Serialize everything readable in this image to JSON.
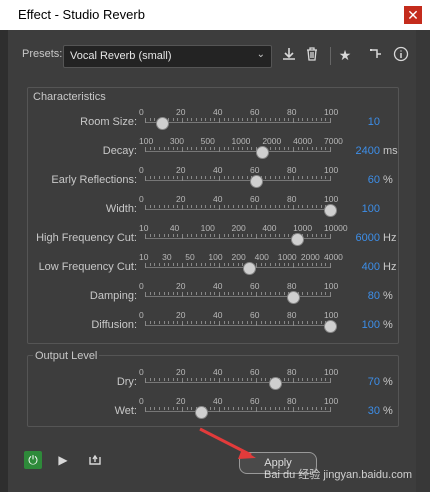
{
  "window": {
    "title": "Effect - Studio Reverb",
    "close_label": "✕"
  },
  "toolbar": {
    "presets_label": "Presets:",
    "preset_value": "Vocal Reverb (small)",
    "icons": [
      "download-icon",
      "trash-icon",
      "star-icon",
      "routing-icon",
      "info-icon"
    ]
  },
  "characteristics": {
    "title": "Characteristics",
    "rows": [
      {
        "label": "Room Size:",
        "scale": [
          "0",
          "20",
          "40",
          "60",
          "80",
          "100"
        ],
        "fraction": 0.09,
        "value": "10",
        "unit": ""
      },
      {
        "label": "Decay:",
        "scale": [
          "100",
          "300",
          "500",
          "1000",
          "2000",
          "4000",
          "7000"
        ],
        "fraction": 0.63,
        "value": "2400",
        "unit": "ms"
      },
      {
        "label": "Early Reflections:",
        "scale": [
          "0",
          "20",
          "40",
          "60",
          "80",
          "100"
        ],
        "fraction": 0.6,
        "value": "60",
        "unit": "%"
      },
      {
        "label": "Width:",
        "scale": [
          "0",
          "20",
          "40",
          "60",
          "80",
          "100"
        ],
        "fraction": 1.0,
        "value": "100",
        "unit": ""
      },
      {
        "label": "High Frequency Cut:",
        "scale": [
          "10",
          "40",
          "100",
          "200",
          "400",
          "1000",
          "10000"
        ],
        "fraction": 0.82,
        "value": "6000",
        "unit": "Hz"
      },
      {
        "label": "Low Frequency Cut:",
        "scale": [
          "10",
          "30",
          "50",
          "100",
          "200",
          "400",
          "1000",
          "2000",
          "4000"
        ],
        "fraction": 0.56,
        "value": "400",
        "unit": "Hz"
      },
      {
        "label": "Damping:",
        "scale": [
          "0",
          "20",
          "40",
          "60",
          "80",
          "100"
        ],
        "fraction": 0.8,
        "value": "80",
        "unit": "%"
      },
      {
        "label": "Diffusion:",
        "scale": [
          "0",
          "20",
          "40",
          "60",
          "80",
          "100"
        ],
        "fraction": 1.0,
        "value": "100",
        "unit": "%"
      }
    ]
  },
  "output": {
    "title": "Output Level",
    "rows": [
      {
        "label": "Dry:",
        "scale": [
          "0",
          "20",
          "40",
          "60",
          "80",
          "100"
        ],
        "fraction": 0.7,
        "value": "70",
        "unit": "%"
      },
      {
        "label": "Wet:",
        "scale": [
          "0",
          "20",
          "40",
          "60",
          "80",
          "100"
        ],
        "fraction": 0.3,
        "value": "30",
        "unit": "%"
      }
    ]
  },
  "bottom": {
    "apply_label": "Apply",
    "watermark": "Bai du 经验 jingyan.baidu.com"
  },
  "colors": {
    "value_blue": "#3d8ee8",
    "power_green": "#2e8a3a",
    "arrow_red": "#e23b3b"
  }
}
